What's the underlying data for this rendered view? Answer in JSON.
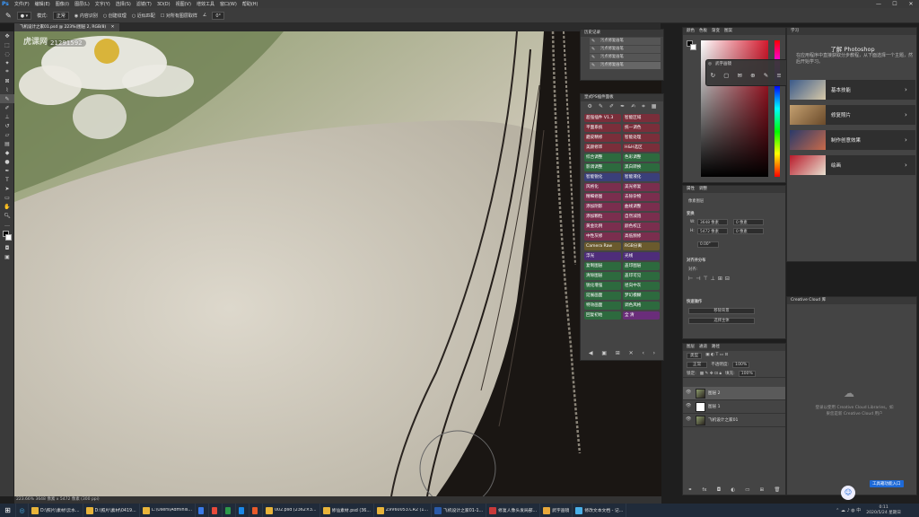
{
  "menubar": {
    "items": [
      "文件(F)",
      "编辑(E)",
      "图像(I)",
      "图层(L)",
      "文字(Y)",
      "选择(S)",
      "滤镜(T)",
      "3D(D)",
      "视图(V)",
      "增效工具",
      "窗口(W)",
      "帮助(H)"
    ],
    "controls": [
      "—",
      "☐",
      "✕"
    ]
  },
  "options": {
    "mode_label": "模式:",
    "mode_value": "正常",
    "opacity_label": "流量:",
    "sample_all": "对所有图层取样",
    "content_aware": "内容识别",
    "create_texture": "创建纹理",
    "proximity": "近似匹配",
    "angle_value": "0°"
  },
  "document": {
    "tab_title": "飞机设计之家01.psd @ 223%(图层 2, RGB/8)",
    "status": "223.66%  3648 像素 x 5472 像素 (300 ppi)",
    "watermark_top": "虎课网",
    "watermark_id": "21291592"
  },
  "actions": {
    "title": "历史记录",
    "items": [
      "污点修复画笔",
      "污点修复画笔",
      "污点修复画笔",
      "污点修复画笔"
    ]
  },
  "plugin": {
    "title": "皇式PS插件面板",
    "buttons": [
      {
        "label": "超强插件 V1.3",
        "color": "#7a2e3a"
      },
      {
        "label": "智能区域",
        "color": "#7a2e3a"
      },
      {
        "label": "平面系统",
        "color": "#7a2e3a"
      },
      {
        "label": "统一调色",
        "color": "#7a2e3a"
      },
      {
        "label": "磨皮精修",
        "color": "#7a2e3a"
      },
      {
        "label": "智能处理",
        "color": "#7a2e3a"
      },
      {
        "label": "美颜修饰",
        "color": "#7a2e3a"
      },
      {
        "label": "H&H选区",
        "color": "#7a2e3a"
      },
      {
        "label": "综合调整",
        "color": "#2d6a3e"
      },
      {
        "label": "色彩调整",
        "color": "#2d6a3e"
      },
      {
        "label": "影调调整",
        "color": "#2d6a3e"
      },
      {
        "label": "黑白转换",
        "color": "#2d6a3e"
      },
      {
        "label": "智能锐化",
        "color": "#3a3f7a"
      },
      {
        "label": "智能液化",
        "color": "#3a3f7a"
      },
      {
        "label": "风格化",
        "color": "#7a2e4e"
      },
      {
        "label": "美光修复",
        "color": "#7a2e4e"
      },
      {
        "label": "精细修图",
        "color": "#7a2e4e"
      },
      {
        "label": "去除杂物",
        "color": "#7a2e4e"
      },
      {
        "label": "添加阴影",
        "color": "#7a2e4e"
      },
      {
        "label": "曲线调整",
        "color": "#7a2e4e"
      },
      {
        "label": "添加颗粒",
        "color": "#7a2e4e"
      },
      {
        "label": "自然减饱",
        "color": "#7a2e4e"
      },
      {
        "label": "黄金比例",
        "color": "#7a2e4e"
      },
      {
        "label": "颜色校正",
        "color": "#7a2e4e"
      },
      {
        "label": "中性灰修",
        "color": "#7a2e4e"
      },
      {
        "label": "高低频修",
        "color": "#7a2e4e"
      },
      {
        "label": "Camera Raw",
        "color": "#6a5a2d"
      },
      {
        "label": "RGB分离",
        "color": "#6a5a2d"
      },
      {
        "label": "浮光",
        "color": "#4e2d7a"
      },
      {
        "label": "光线",
        "color": "#4e2d7a"
      },
      {
        "label": "复制图层",
        "color": "#2d6a3e"
      },
      {
        "label": "盖印图层",
        "color": "#2d6a3e"
      },
      {
        "label": "清除图层",
        "color": "#2d6a3e"
      },
      {
        "label": "盖印可见",
        "color": "#2d6a3e"
      },
      {
        "label": "锐化增强",
        "color": "#2d6a3e"
      },
      {
        "label": "径向中灰",
        "color": "#2d6a3e"
      },
      {
        "label": "延展画面",
        "color": "#2d6a3e"
      },
      {
        "label": "梦幻模糊",
        "color": "#2d6a3e"
      },
      {
        "label": "特效画面",
        "color": "#2d6a3e"
      },
      {
        "label": "调色风格",
        "color": "#2d6a3e"
      },
      {
        "label": "回复初始",
        "color": "#2d6a3e"
      },
      {
        "label": "全 清",
        "color": "#6a2d7a"
      }
    ]
  },
  "colorpanel": {
    "tabs": [
      "颜色",
      "色板",
      "渐变",
      "图案"
    ],
    "fg": "#000000",
    "bg": "#ffffff"
  },
  "floatbar": {
    "title": "武字画镜"
  },
  "properties": {
    "tabs": [
      "属性",
      "调整"
    ],
    "layer_type": "像素图层",
    "transform": "变换",
    "w_label": "W:",
    "w_value": "3648 像素",
    "h_label": "H:",
    "h_value": "5472 像素",
    "x_value": "0 像素",
    "y_value": "0 像素",
    "angle": "0.00°",
    "align": "对齐并分布",
    "align_label": "对齐:",
    "quick": "快速操作",
    "btn1": "移除背景",
    "btn2": "选择主体"
  },
  "layers": {
    "tabs": [
      "图层",
      "通道",
      "路径"
    ],
    "kind": "类型",
    "blend": "正常",
    "opacity_label": "不透明度:",
    "opacity": "100%",
    "lock_label": "锁定:",
    "fill_label": "填充:",
    "fill": "100%",
    "list": [
      {
        "name": "图层 2",
        "selected": true
      },
      {
        "name": "图层 1",
        "selected": false
      },
      {
        "name": "飞机设计之家01",
        "selected": false
      }
    ]
  },
  "learn": {
    "tabs": [
      "学习"
    ],
    "title": "了解 Photoshop",
    "desc": "在应用程序中直接获取分步教程，从下面选择一个主题，然后开始学习。",
    "cards": [
      "基本技能",
      "修复照片",
      "制作创意效果",
      "绘画"
    ]
  },
  "libraries": {
    "title": "Creative Cloud 库",
    "msg1": "登录以使用 Creative Cloud Libraries。如",
    "msg2": "果您是新 Creative Cloud 用户"
  },
  "taskbar": {
    "items": [
      {
        "label": "D:\\照片\\素材\\云水...",
        "color": "#e8b43a"
      },
      {
        "label": "D:\\照片\\素材\\0419...",
        "color": "#e8b43a"
      },
      {
        "label": "C:\\Users\\Adminis...",
        "color": "#e8b43a"
      },
      {
        "label": "",
        "color": "#3a7ae8"
      },
      {
        "label": "",
        "color": "#e84a3a"
      },
      {
        "label": "",
        "color": "#2d9a4a"
      },
      {
        "label": "",
        "color": "#1a88e8"
      },
      {
        "label": "",
        "color": "#e85a2a"
      },
      {
        "label": "002.psd (2362×3...",
        "color": "#e8b43a"
      },
      {
        "label": "修仙素材.psd (36...",
        "color": "#e8b43a"
      },
      {
        "label": "Z9V60053.CR2 (1...",
        "color": "#e8b43a"
      },
      {
        "label": "飞机设计之家01-1...",
        "color": "#2a5aa8"
      },
      {
        "label": "修复人像头发局部...",
        "color": "#c83a3a"
      },
      {
        "label": "武字画镜",
        "color": "#e8a83a"
      },
      {
        "label": "修改文本文档 - 记...",
        "color": "#4ab0e8"
      }
    ],
    "time": "0:11",
    "date": "2020/5/24 星期日",
    "toast": "工具箱功能入口"
  }
}
